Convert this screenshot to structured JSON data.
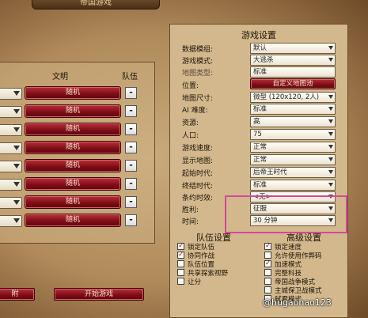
{
  "window": {
    "banner_title": "帝国游戏"
  },
  "left": {
    "col_civ": "文明",
    "col_team": "队伍",
    "rows": [
      {
        "civ": "随机",
        "team": "-"
      },
      {
        "civ": "随机",
        "team": "-"
      },
      {
        "civ": "随机",
        "team": "-"
      },
      {
        "civ": "随机",
        "team": "-"
      },
      {
        "civ": "随机",
        "team": "-"
      },
      {
        "civ": "随机",
        "team": "-"
      },
      {
        "civ": "随机",
        "team": "-"
      },
      {
        "civ": "随机",
        "team": "-"
      }
    ]
  },
  "bottom": {
    "left_button": "附",
    "start_button": "开始游戏"
  },
  "settings": {
    "title": "游戏设置",
    "rows": [
      {
        "label": "数据模组:",
        "value": "默认"
      },
      {
        "label": "游戏模式:",
        "value": "大逃杀"
      },
      {
        "label": "地图类型:",
        "value": "标准"
      },
      {
        "label": "位置:",
        "value": "自定义地图池"
      },
      {
        "label": "地图尺寸:",
        "value": "微型 (120x120, 2人)"
      },
      {
        "label": "AI 难度:",
        "value": "标准"
      },
      {
        "label": "资源:",
        "value": "高"
      },
      {
        "label": "人口:",
        "value": "75"
      },
      {
        "label": "游戏速度:",
        "value": "正常"
      },
      {
        "label": "显示地图:",
        "value": "正常"
      },
      {
        "label": "起始时代:",
        "value": "后帝王时代"
      },
      {
        "label": "终结时代:",
        "value": "标准"
      },
      {
        "label": "条约时效:",
        "value": "<无>"
      },
      {
        "label": "胜利:",
        "value": "征服"
      },
      {
        "label": "时间:",
        "value": "30 分钟"
      }
    ]
  },
  "team_settings": {
    "title": "队伍设置",
    "options": [
      {
        "label": "锁定队伍",
        "checked": true
      },
      {
        "label": "协同作战",
        "checked": true
      },
      {
        "label": "队伍位置",
        "checked": false
      },
      {
        "label": "共享探索视野",
        "checked": false
      },
      {
        "label": "让分",
        "checked": false
      }
    ]
  },
  "advanced_settings": {
    "title": "高级设置",
    "options": [
      {
        "label": "锁定速度",
        "checked": true
      },
      {
        "label": "允许使用作弊码",
        "checked": false
      },
      {
        "label": "加速模式",
        "checked": true
      },
      {
        "label": "完整科技",
        "checked": false
      },
      {
        "label": "帝国战争模式",
        "checked": false
      },
      {
        "label": "主城保卫战模式",
        "checked": false
      },
      {
        "label": "弑君模式",
        "checked": false
      }
    ]
  },
  "watermark": "@hugaohao123",
  "colors": {
    "accent_red": "#7c0c14",
    "highlight": "#d6489a",
    "panel": "#d2b88c"
  }
}
